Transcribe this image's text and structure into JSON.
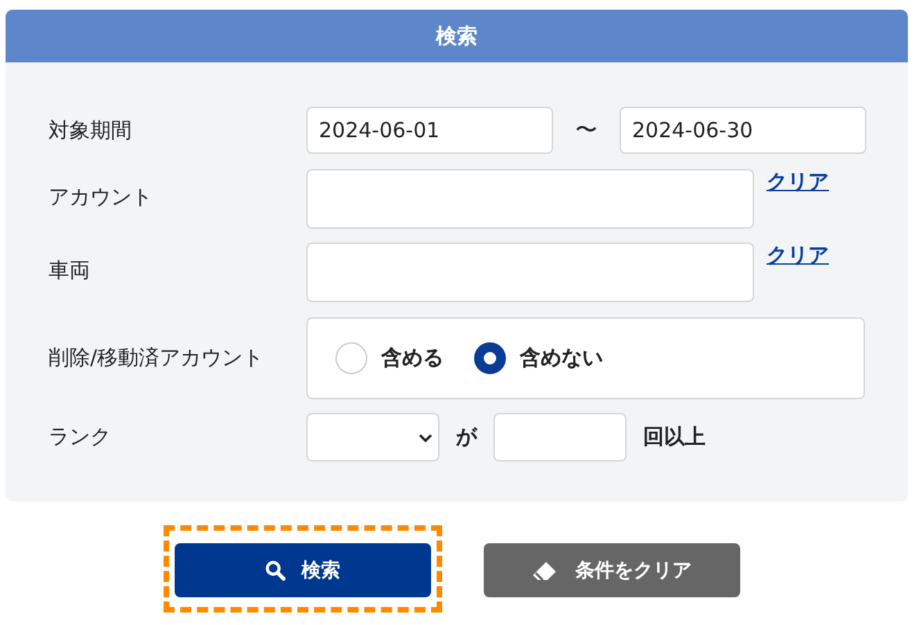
{
  "panel": {
    "title": "検索"
  },
  "period": {
    "label": "対象期間",
    "from": "2024-06-01",
    "separator": "〜",
    "to": "2024-06-30"
  },
  "text_fields": [
    {
      "label": "アカウント",
      "clear_link": "クリア"
    },
    {
      "label": "車両",
      "clear_link": "クリア"
    }
  ],
  "deleted_accounts": {
    "label": "削除/移動済アカウント",
    "options": [
      {
        "label": "含める",
        "selected": false
      },
      {
        "label": "含めない",
        "selected": true
      }
    ]
  },
  "rank": {
    "label": "ランク",
    "particle": "が",
    "suffix": "回以上"
  },
  "buttons": [
    {
      "kind": "search",
      "label": "検索",
      "focused": true
    },
    {
      "kind": "clear",
      "label": "条件をクリア",
      "focused": false
    }
  ]
}
